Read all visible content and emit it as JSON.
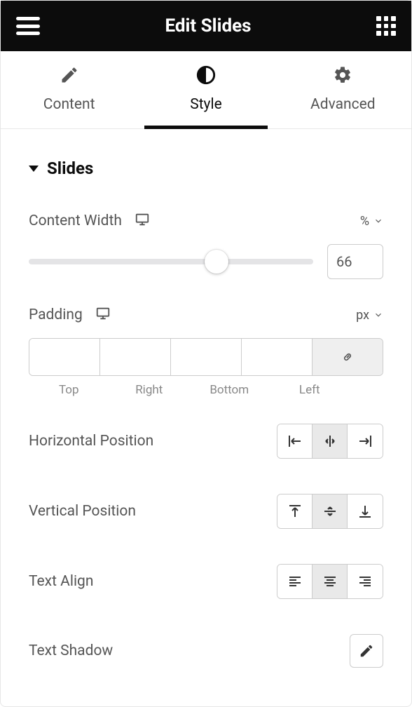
{
  "header": {
    "title": "Edit Slides"
  },
  "tabs": {
    "content": "Content",
    "style": "Style",
    "advanced": "Advanced",
    "active": "style"
  },
  "section": {
    "title": "Slides"
  },
  "contentWidth": {
    "label": "Content Width",
    "unit": "%",
    "value": "66",
    "percent": 66
  },
  "padding": {
    "label": "Padding",
    "unit": "px",
    "topLabel": "Top",
    "rightLabel": "Right",
    "bottomLabel": "Bottom",
    "leftLabel": "Left",
    "top": "",
    "right": "",
    "bottom": "",
    "left": ""
  },
  "horizontal": {
    "label": "Horizontal Position",
    "active": "center"
  },
  "vertical": {
    "label": "Vertical Position",
    "active": "middle"
  },
  "textAlign": {
    "label": "Text Align",
    "active": "center"
  },
  "textShadow": {
    "label": "Text Shadow"
  }
}
